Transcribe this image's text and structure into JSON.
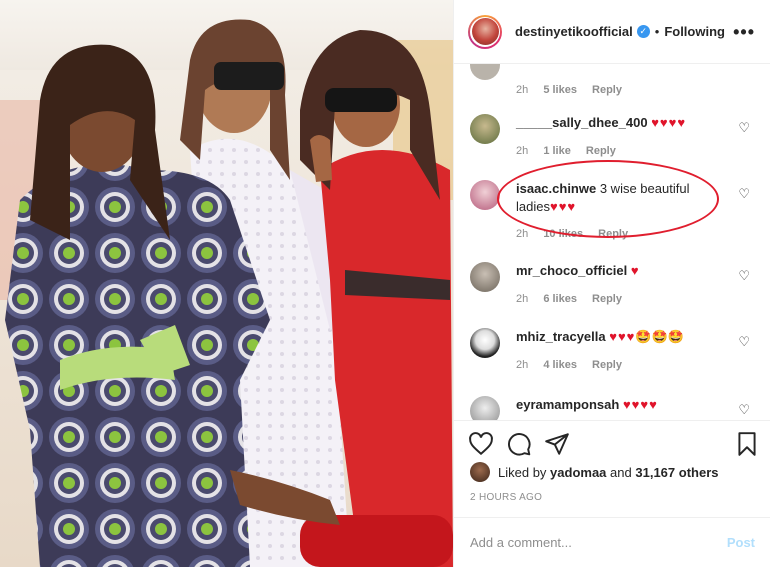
{
  "header": {
    "username": "destinyetikoofficial",
    "separator": "•",
    "following": "Following",
    "more": "•••"
  },
  "comments": [
    {
      "user": "",
      "text": "",
      "time": "2h",
      "likes": "5 likes",
      "reply": "Reply"
    },
    {
      "user": "_____sally_dhee_400",
      "text": "",
      "hearts": "♥♥♥♥",
      "time": "2h",
      "likes": "1 like",
      "reply": "Reply"
    },
    {
      "user": "isaac.chinwe",
      "text": "3 wise beautiful ladies",
      "hearts": "♥♥♥",
      "time": "2h",
      "likes": "10 likes",
      "reply": "Reply"
    },
    {
      "user": "mr_choco_officiel",
      "text": "",
      "hearts": "♥",
      "time": "2h",
      "likes": "6 likes",
      "reply": "Reply"
    },
    {
      "user": "mhiz_tracyella",
      "text": "",
      "hearts": "♥♥♥",
      "emoji": "🤩🤩🤩",
      "time": "2h",
      "likes": "4 likes",
      "reply": "Reply"
    },
    {
      "user": "eyramamponsah",
      "text": "",
      "hearts": "♥♥♥♥"
    }
  ],
  "post": {
    "liked_by_prefix": "Liked by",
    "liked_by_user": "yadomaa",
    "and": "and",
    "others": "31,167 others",
    "time": "2 HOURS AGO"
  },
  "composer": {
    "placeholder": "Add a comment...",
    "post_label": "Post"
  },
  "colors": {
    "verified": "#3897f0",
    "heart": "#e0142b",
    "highlight_circle": "#e01e2e",
    "post_disabled": "#b2dffc"
  }
}
